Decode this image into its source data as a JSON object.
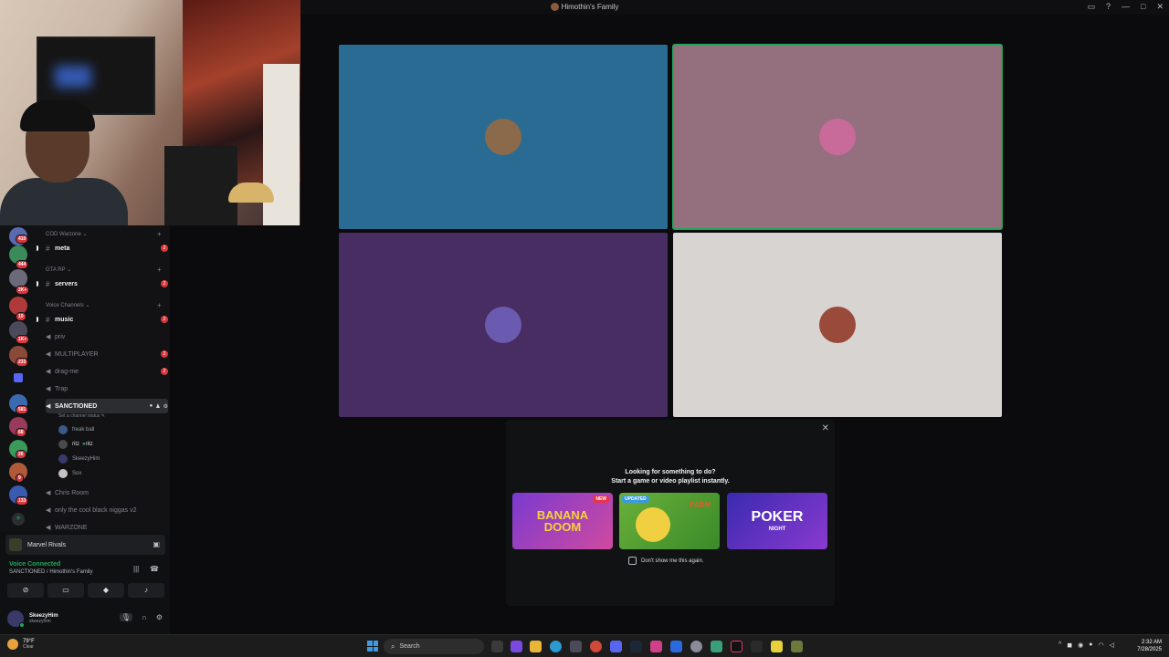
{
  "window": {
    "title": "Himothin's Family"
  },
  "webcam": {
    "label": "streamer-webcam"
  },
  "servers": {
    "badges": [
      "410",
      "444",
      "2K+",
      "10",
      "1K+",
      "233",
      "581",
      "68",
      "26",
      "9",
      "133"
    ]
  },
  "channels": {
    "categories": [
      {
        "name": "COD Warzone"
      },
      {
        "name": "GTA RP"
      },
      {
        "name": "Voice Channels"
      }
    ],
    "text": [
      {
        "name": "meta",
        "badge": "2"
      },
      {
        "name": "servers",
        "badge": "2"
      },
      {
        "name": "music",
        "badge": "2"
      }
    ],
    "voice": [
      {
        "name": "priv",
        "badge": ""
      },
      {
        "name": "MULTIPLAYER",
        "badge": "2"
      },
      {
        "name": "drag-me",
        "badge": "2"
      },
      {
        "name": "Trap",
        "badge": ""
      },
      {
        "name": "SANCTIONED",
        "badge": ""
      },
      {
        "name": "Chris Room",
        "badge": ""
      },
      {
        "name": "only the cool black niggas v2",
        "badge": ""
      },
      {
        "name": "WARZONE",
        "badge": ""
      }
    ],
    "active_status": "Set a channel status",
    "voice_users": [
      {
        "name": "freak ball",
        "tag": "",
        "color": "#3a5a8a"
      },
      {
        "name": "ritz",
        "tag": "ritz",
        "color": "#4a4a4a"
      },
      {
        "name": "SkeezyHim",
        "tag": "",
        "color": "#3a3a6a"
      },
      {
        "name": "Sox",
        "tag": "",
        "color": "#c9c2c2"
      }
    ]
  },
  "panel": {
    "activity": "Marvel Rivals",
    "voice_status": "Voice Connected",
    "voice_location": "SANCTIONED / Himothin's Family",
    "user_name": "SkeezyHim",
    "user_handle": "skeezyhim"
  },
  "tiles": [
    {
      "color": "#2a6b93",
      "avatar": "#8a6a4a",
      "speaking": false
    },
    {
      "color": "#94707f",
      "avatar": "#c86a9a",
      "speaking": true
    },
    {
      "color": "#472d61",
      "avatar": "#6a5ab0",
      "speaking": false
    },
    {
      "color": "#d8d4d1",
      "avatar": "#9a4a3a",
      "speaking": false
    }
  ],
  "popup": {
    "line1": "Looking for something to do?",
    "line2": "Start a game or video playlist instantly.",
    "dont_show": "Don't show me this again.",
    "games": [
      {
        "title": "BANANA DOOM",
        "tag": "NEW"
      },
      {
        "title": "FARM",
        "tag": "UPDATED"
      },
      {
        "title": "POKER",
        "sub": "NIGHT",
        "tag": ""
      }
    ]
  },
  "taskbar": {
    "temp": "79°F",
    "condition": "Clear",
    "search": "Search",
    "time": "2:32 AM",
    "date": "7/28/2025"
  }
}
